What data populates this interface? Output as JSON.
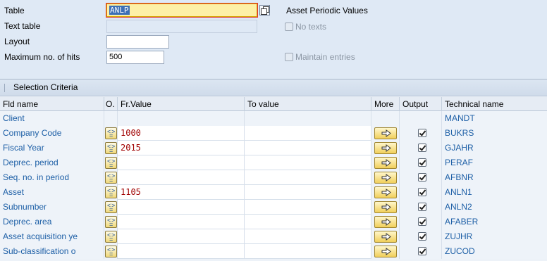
{
  "header": {
    "table_label": "Table",
    "table_value": "ANLP",
    "text_table_label": "Text table",
    "layout_label": "Layout",
    "max_hits_label": "Maximum no. of hits",
    "max_hits_value": "500",
    "table_description": "Asset Periodic Values",
    "no_texts_label": "No texts",
    "maintain_entries_label": "Maintain entries"
  },
  "selection": {
    "title": "Selection Criteria",
    "columns": {
      "fld_name": "Fld name",
      "op": "O.",
      "fr_value": "Fr.Value",
      "to_value": "To value",
      "more": "More",
      "output": "Output",
      "technical_name": "Technical name"
    },
    "rows": [
      {
        "name": "Client",
        "from": "",
        "to": "",
        "tech": "MANDT"
      },
      {
        "name": "Company Code",
        "from": "1000",
        "to": "",
        "tech": "BUKRS"
      },
      {
        "name": "Fiscal Year",
        "from": "2015",
        "to": "",
        "tech": "GJAHR"
      },
      {
        "name": "Deprec. period",
        "from": "",
        "to": "",
        "tech": "PERAF"
      },
      {
        "name": "Seq. no. in period",
        "from": "",
        "to": "",
        "tech": "AFBNR"
      },
      {
        "name": "Asset",
        "from": "1105",
        "to": "",
        "tech": "ANLN1"
      },
      {
        "name": "Subnumber",
        "from": "",
        "to": "",
        "tech": "ANLN2"
      },
      {
        "name": "Deprec. area",
        "from": "",
        "to": "",
        "tech": "AFABER"
      },
      {
        "name": "Asset acquisition ye",
        "from": "",
        "to": "",
        "tech": "ZUJHR"
      },
      {
        "name": "Sub-classification o",
        "from": "",
        "to": "",
        "tech": "ZUCOD"
      }
    ]
  },
  "colors": {
    "background": "#dfe9f5",
    "field_label_blue": "#1d5fa6",
    "value_red": "#a00000",
    "active_field": "#fdf0a6"
  }
}
